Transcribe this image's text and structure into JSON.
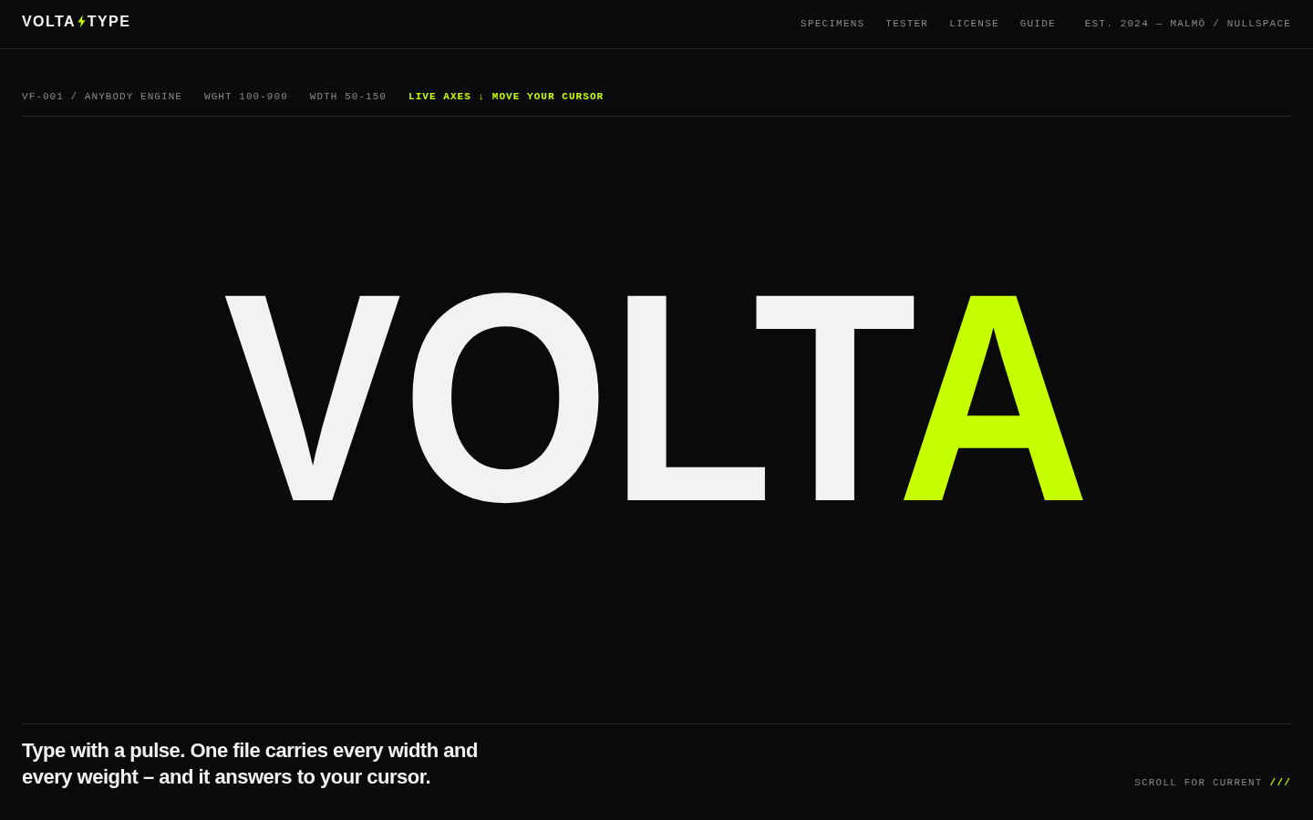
{
  "header": {
    "logo": {
      "left": "VOLTA",
      "right": "TYPE"
    },
    "nav": [
      "SPECIMENS",
      "TESTER",
      "LICENSE",
      "GUIDE"
    ],
    "note": "EST. 2024 — MALMÖ / NULLSPACE"
  },
  "meta": [
    {
      "text": "VF-001 / ANYBODY ENGINE",
      "highlight": false
    },
    {
      "text": "WGHT 100-900",
      "highlight": false
    },
    {
      "text": "WDTH 50-150",
      "highlight": false
    },
    {
      "text": "LIVE AXES ↓ MOVE YOUR CURSOR",
      "highlight": true
    }
  ],
  "hero": {
    "segments": [
      {
        "text": "VOLT",
        "accent": false
      },
      {
        "text": "A",
        "accent": true
      }
    ]
  },
  "footer": {
    "tagline": "Type with a pulse. One file carries every width and every weight – and it answers to your cursor.",
    "scroll_hint": "SCROLL FOR CURRENT",
    "scroll_marker": "///"
  }
}
